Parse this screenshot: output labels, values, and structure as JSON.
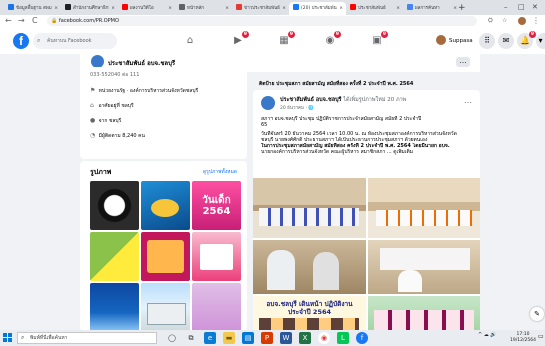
{
  "browser": {
    "tabs": [
      {
        "title": "ข้อมูลพื้นฐาน สพม.",
        "icon_color": "#1a73e8"
      },
      {
        "title": "สำนักงานศึกษาธิการ",
        "icon_color": "#202124"
      },
      {
        "title": "ผลงานวิดีโอ",
        "icon_color": "#ff0000"
      },
      {
        "title": "หน้าหลัก",
        "icon_color": "#5f6368"
      },
      {
        "title": "ข่าวประชาสัมพันธ์",
        "icon_color": "#e53935"
      },
      {
        "title": "(20) ประชาสัมพันธ์",
        "icon_color": "#1877f2",
        "active": true
      },
      {
        "title": "ประชาสัมพันธ์",
        "icon_color": "#ff0000"
      },
      {
        "title": "ผลการค้นหา",
        "icon_color": "#4285f4"
      }
    ],
    "new_tab": "+",
    "window_controls": [
      "–",
      "□",
      "✕"
    ],
    "url": "facebook.com/PR.OPMO",
    "nav": {
      "back": "←",
      "forward": "→",
      "reload": "C"
    }
  },
  "fb": {
    "logo": "f",
    "search_placeholder": "ค้นหาบน Facebook",
    "nav_badges": [
      "",
      "9",
      "9",
      "9",
      "9"
    ],
    "profile_name": "Suppasa",
    "right_badges": {
      "notifications": "9",
      "messenger": "1"
    }
  },
  "page": {
    "name": "ประชาสัมพันธ์ อบจ.ชลบุรี",
    "intro": [
      {
        "icon": "info-icon",
        "text": "033-552040 ต่อ 111"
      },
      {
        "icon": "flag-icon",
        "text": "หน่วยงานรัฐ · องค์การบริหารส่วนจังหวัดชลบุรี"
      },
      {
        "icon": "location-icon",
        "text": "อาศัยอยู่ที่ ชลบุรี"
      },
      {
        "icon": "home-icon",
        "text": "จาก ชลบุรี"
      },
      {
        "icon": "followers-icon",
        "text": "มีผู้ติดตาม 8,240 คน"
      }
    ],
    "photos": {
      "title": "รูปภาพ",
      "see_all": "ดูรูปภาพทั้งหมด",
      "thumb_texts": [
        "",
        "วันเด็ก 2564",
        "",
        "",
        "",
        "",
        "",
        "",
        ""
      ]
    }
  },
  "post": {
    "banner": "ติดป้าย ประชุมสภา สมัยสามัญ สมัยที่สอง ครั้งที่ 2 ประจำปี พ.ศ. 2564",
    "author": "ประชาสัมพันธ์ อบจ.ชลบุรี",
    "author_suffix": " ได้เพิ่มรูปภาพใหม่ 20 ภาพ",
    "time": "20 ธันวาคม · 🌐",
    "lines": [
      "สภาฯ อบจ.ชลบุรี ประชุม ปฏิบัติราชการประจำสมัยสามัญ สมัยที่ 2 ประจำปี",
      "65",
      "วันที่จันทร์ 20 ธันวาคม 2564 เวลา 10.00 น. ณ ห้องประชุมสภาองค์การบริหารส่วนจังหวัด",
      "ชลบุรี นายพงศ์ศักดิ์ ประธานสภาฯ ได้เป็นประธานการประชุมสภาฯ ด้วยตนเอง",
      "ในการประชุมสภาสมัยสามัญ สมัยที่สอง ครั้งที่ 2 ประจำปี พ.ศ. 2564 โดยมีนายก อบจ.",
      "นายกองค์การบริหารส่วนจังหวัด คณะผู้บริหาร สมาชิกสภา ... ดูเพิ่มเติม"
    ],
    "caption_image": "อบจ.ชลบุรี เดินหน้า ปฏิบัติงานประจำปี 2564"
  },
  "taskbar": {
    "search_placeholder": "พิมพ์ที่นี่เพื่อค้นหา",
    "tray": "^ ☁ 🔊",
    "time": "17:10",
    "date": "19/12/2564"
  }
}
